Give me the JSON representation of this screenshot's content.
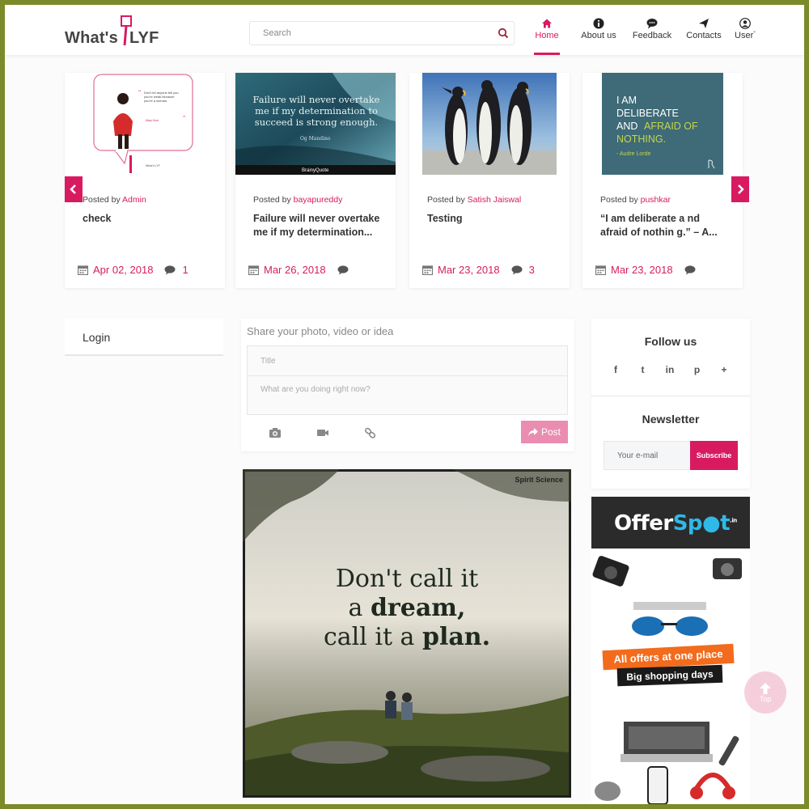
{
  "header": {
    "logo_text": "What's",
    "logo_text2": "LYF",
    "search_placeholder": "Search",
    "nav": [
      {
        "label": "Home",
        "icon": "home-icon",
        "active": true
      },
      {
        "label": "About us",
        "icon": "info-icon"
      },
      {
        "label": "Feedback",
        "icon": "chat-icon"
      },
      {
        "label": "Contacts",
        "icon": "send-icon"
      },
      {
        "label": "User",
        "icon": "user-icon"
      }
    ],
    "accent": "#d81b60"
  },
  "carousel": {
    "posted_prefix": "Posted by",
    "cards": [
      {
        "author": "Admin",
        "title": "check",
        "date": "Apr 02, 2018",
        "comments": "1"
      },
      {
        "author": "bayapureddy",
        "title": "Failure will never overtake me if my determination...",
        "date": "Mar 26, 2018",
        "comments": ""
      },
      {
        "author": "Satish Jaiswal",
        "title": "Testing",
        "date": "Mar 23, 2018",
        "comments": "3"
      },
      {
        "author": "pushkar",
        "title": "“I am deliberate a nd afraid of nothin g.” – A...",
        "date": "Mar 23, 2018",
        "comments": ""
      }
    ],
    "thumb_texts": {
      "speech_quote": "Don't let anyone tell you you're weak because you're a woman.",
      "speech_author": "Mary Kom",
      "speech_brand": "What's LYF",
      "wave_quote": "Failure will never overtake me if my determination to succeed is strong enough.",
      "wave_author": "Og Mandino",
      "wave_brand": "BrainyQuote",
      "deliberate_quote_1": "I AM",
      "deliberate_quote_2": "DELIBERATE",
      "deliberate_quote_3": "AND",
      "deliberate_quote_4": "AFRAID OF",
      "deliberate_quote_5": "NOTHING.",
      "deliberate_author": "- Audre Lorde"
    }
  },
  "sidebar_left": {
    "login_label": "Login"
  },
  "share": {
    "heading": "Share your photo, video or idea",
    "title_placeholder": "Title",
    "body_placeholder": "What are you doing right now?",
    "post_label": "Post"
  },
  "feed": {
    "brand": "Spirit Science",
    "line1": "Don't call it",
    "line2a": "a ",
    "line2b": "dream,",
    "line3a": "call it a ",
    "line3b": "plan."
  },
  "sidebar_right": {
    "follow_title": "Follow us",
    "socials": [
      "f",
      "t",
      "in",
      "p",
      "+"
    ],
    "newsletter_title": "Newsletter",
    "email_placeholder": "Your e-mail",
    "subscribe_label": "Subscribe"
  },
  "ad": {
    "brand1": "Offer",
    "brand2": "Sp",
    "brand3": "t",
    "brand_sup": ".in",
    "ribbon1": "All offers at one place",
    "ribbon2": "Big shopping days"
  },
  "top_button": {
    "label": "Top"
  }
}
